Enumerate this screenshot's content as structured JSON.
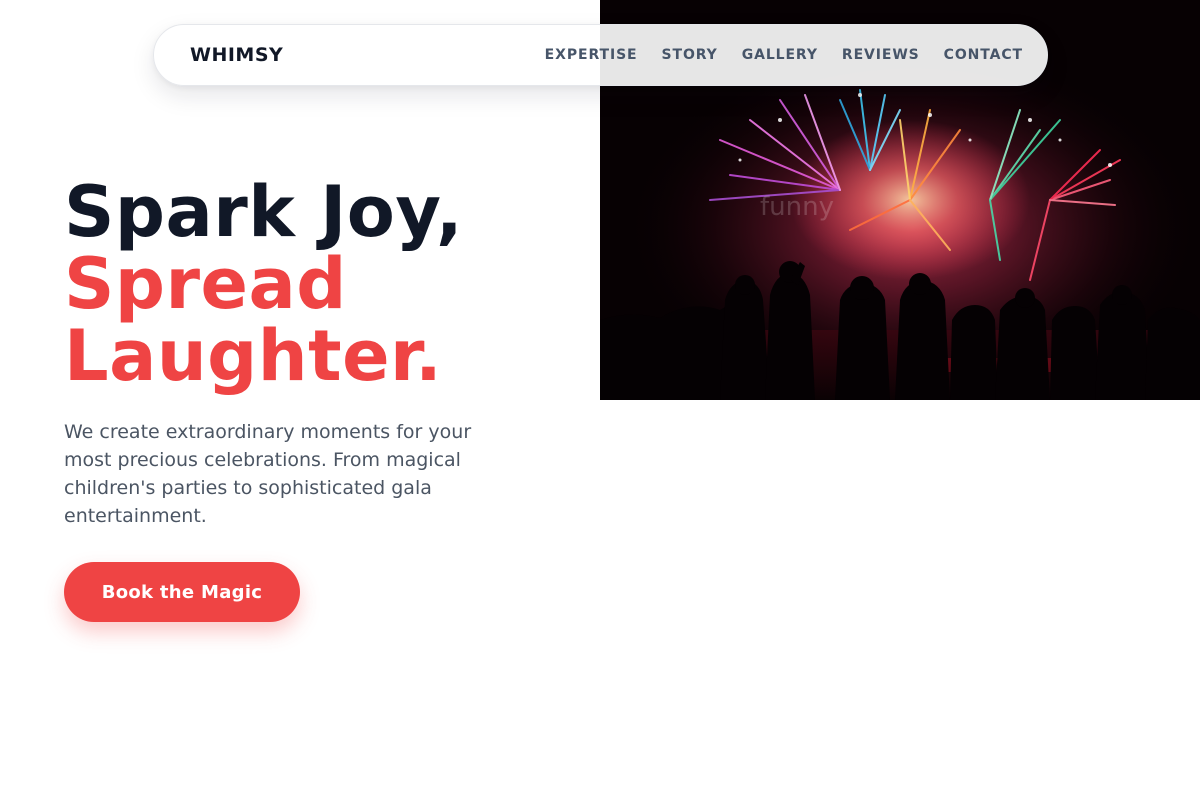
{
  "brand": {
    "name": "WHIMSY"
  },
  "nav": {
    "links": [
      {
        "label": "EXPERTISE"
      },
      {
        "label": "STORY"
      },
      {
        "label": "GALLERY"
      },
      {
        "label": "REVIEWS"
      },
      {
        "label": "CONTACT"
      }
    ]
  },
  "hero": {
    "headline_line1": "Spark Joy,",
    "headline_line2": "Spread",
    "headline_line3": "Laughter.",
    "description": "We create extraordinary moments for your most precious celebrations. From magical children's parties to sophisticated gala entertainment.",
    "cta_label": "Book the Magic",
    "image_alt": "Crowd silhouetted against a colorful fireworks display",
    "image_watermark": "funny"
  },
  "colors": {
    "accent": "#ef4444",
    "heading": "#111827",
    "body_text": "#4b5563",
    "nav_text": "#475569"
  }
}
